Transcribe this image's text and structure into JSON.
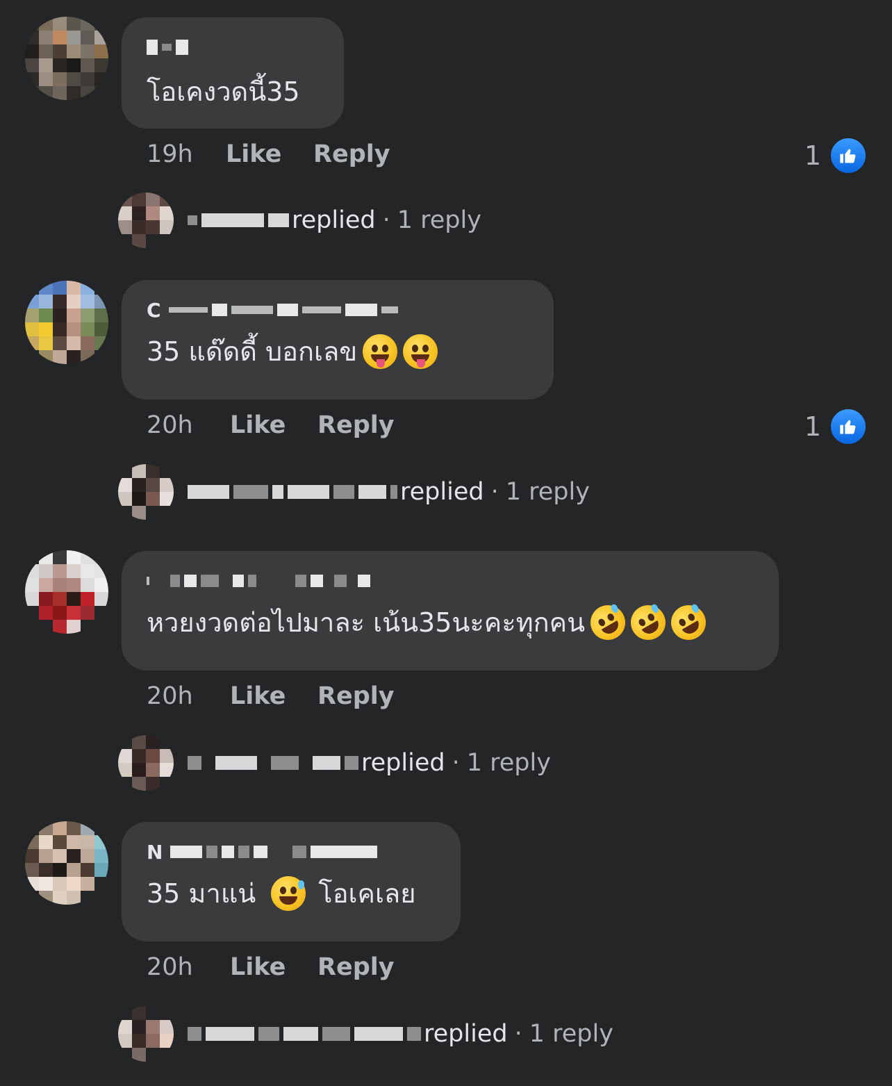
{
  "comments": [
    {
      "author_visible": "",
      "text": "โอเคงวดนี้35",
      "emojis": [],
      "time": "19h",
      "like_label": "Like",
      "reply_label": "Reply",
      "reaction_count": "1",
      "reply_summary": {
        "action": "replied",
        "count_label": "1 reply",
        "separator": "·",
        "name_fragment": ""
      }
    },
    {
      "author_visible": "C",
      "text": "35 แด๊ดดี้ บอกเลข",
      "emojis": [
        "zany-face-emoji",
        "winking-face-with-tongue-emoji"
      ],
      "time": "20h",
      "like_label": "Like",
      "reply_label": "Reply",
      "reaction_count": "1",
      "reply_summary": {
        "action": "replied",
        "count_label": "1 reply",
        "separator": "·",
        "name_fragment": ""
      }
    },
    {
      "author_visible": "",
      "text": "หวยงวดต่อไปมาละ เน้น35นะคะทุกคน",
      "emojis": [
        "rolling-on-floor-laughing-emoji",
        "rolling-on-floor-laughing-emoji",
        "rolling-on-floor-laughing-emoji"
      ],
      "time": "20h",
      "like_label": "Like",
      "reply_label": "Reply",
      "reaction_count": "",
      "reply_summary": {
        "action": "replied",
        "count_label": "1 reply",
        "separator": "·",
        "name_fragment": ""
      }
    },
    {
      "author_visible": "N",
      "text": "35 มาแน่",
      "text_after": "โอเคเลย",
      "emojis": [
        "grinning-face-with-sweat-emoji"
      ],
      "time": "20h",
      "like_label": "Like",
      "reply_label": "Reply",
      "reaction_count": "",
      "reply_summary": {
        "action": "replied",
        "count_label": "1 reply",
        "separator": "·",
        "name_fragment": ""
      }
    }
  ],
  "colors": {
    "background": "#242526",
    "bubble": "#3a3b3c",
    "primary_text": "#e4e6eb",
    "secondary_text": "#b0b3b8",
    "like_blue": "#1877f2"
  }
}
